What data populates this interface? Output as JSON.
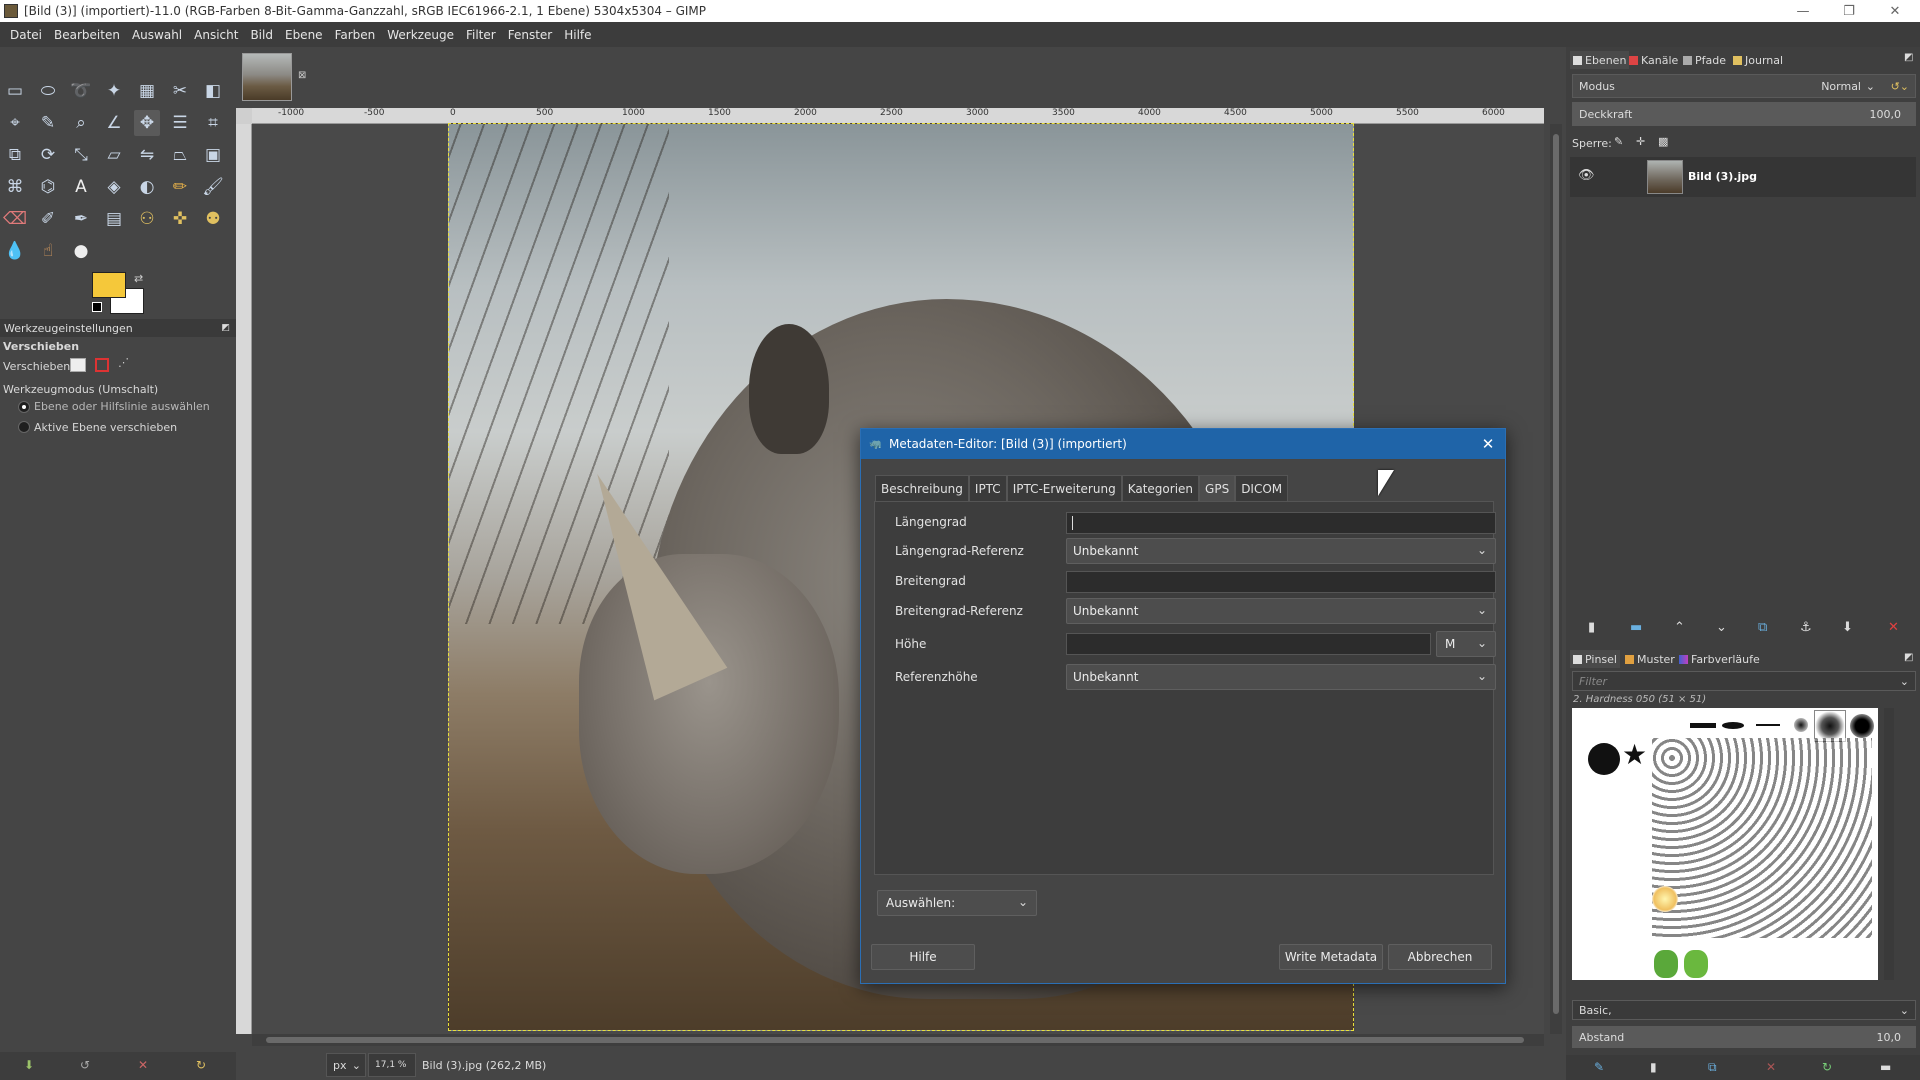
{
  "window": {
    "title": "[Bild (3)] (importiert)-11.0 (RGB-Farben 8-Bit-Gamma-Ganzzahl, sRGB IEC61966-2.1, 1 Ebene) 5304x5304 – GIMP",
    "controls": [
      "—",
      "❐",
      "✕"
    ]
  },
  "menu": [
    "Datei",
    "Bearbeiten",
    "Auswahl",
    "Ansicht",
    "Bild",
    "Ebene",
    "Farben",
    "Werkzeuge",
    "Filter",
    "Fenster",
    "Hilfe"
  ],
  "toolbox": {
    "options_tab": "Werkzeugeinstellungen",
    "tool_name": "Verschieben",
    "move_label": "Verschieben:",
    "mode_label": "Werkzeugmodus (Umschalt)",
    "radio1": "Ebene oder Hilfslinie auswählen",
    "radio2": "Aktive Ebene verschieben",
    "fg_color": "#f5c83a",
    "bg_color": "#ffffff"
  },
  "ruler": {
    "h_labels": [
      "-1000",
      "-500",
      "0",
      "500",
      "1000",
      "1500",
      "2000",
      "2500",
      "3000",
      "3500",
      "4000",
      "4500",
      "5000",
      "5500",
      "6000"
    ]
  },
  "status": {
    "unit": "px",
    "zoom": "17,1 %",
    "info": "Bild (3).jpg (262,2 MB)"
  },
  "dock": {
    "tabs": [
      "Ebenen",
      "Kanäle",
      "Pfade",
      "Journal"
    ],
    "mode_label": "Modus",
    "mode_value": "Normal",
    "opacity_label": "Deckkraft",
    "opacity_value": "100,0",
    "lock_label": "Sperre:",
    "layer_name": "Bild (3).jpg",
    "brush_tabs": [
      "Pinsel",
      "Muster",
      "Farbverläufe"
    ],
    "filter_placeholder": "Filter",
    "brush_name": "2. Hardness 050 (51 × 51)",
    "brush_set": "Basic,",
    "spacing_label": "Abstand",
    "spacing_value": "10,0"
  },
  "dialog": {
    "title": "Metadaten-Editor: [Bild (3)] (importiert)",
    "tabs": [
      "Beschreibung",
      "IPTC",
      "IPTC-Erweiterung",
      "Kategorien",
      "GPS",
      "DICOM"
    ],
    "active_tab": "GPS",
    "fields": {
      "lon_label": "Längengrad",
      "lon_value": "",
      "lonref_label": "Längengrad-Referenz",
      "lonref_value": "Unbekannt",
      "lat_label": "Breitengrad",
      "lat_value": "",
      "latref_label": "Breitengrad-Referenz",
      "latref_value": "Unbekannt",
      "alt_label": "Höhe",
      "alt_value": "",
      "alt_unit": "M",
      "altref_label": "Referenzhöhe",
      "altref_value": "Unbekannt"
    },
    "select_label": "Auswählen:",
    "help_button": "Hilfe",
    "write_button": "Write Metadata",
    "cancel_button": "Abbrechen"
  }
}
